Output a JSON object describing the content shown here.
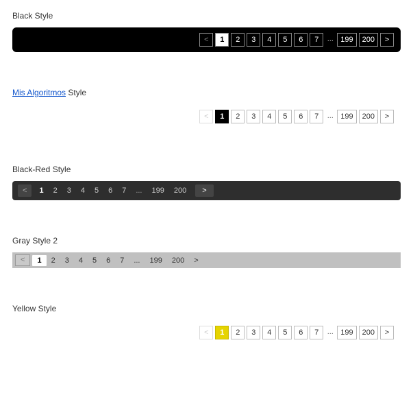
{
  "styles": [
    {
      "id": "black",
      "title_parts": [
        {
          "text": "Black Style",
          "link": false
        }
      ],
      "bar_class": "black-bar",
      "align": "right",
      "items": [
        {
          "t": "<",
          "role": "prev",
          "disabled": true
        },
        {
          "t": "1",
          "role": "page",
          "current": true
        },
        {
          "t": "2",
          "role": "page"
        },
        {
          "t": "3",
          "role": "page"
        },
        {
          "t": "4",
          "role": "page"
        },
        {
          "t": "5",
          "role": "page"
        },
        {
          "t": "6",
          "role": "page"
        },
        {
          "t": "7",
          "role": "page"
        },
        {
          "t": "...",
          "role": "ellipsis"
        },
        {
          "t": "199",
          "role": "page"
        },
        {
          "t": "200",
          "role": "page"
        },
        {
          "t": ">",
          "role": "next"
        }
      ]
    },
    {
      "id": "mis",
      "title_parts": [
        {
          "text": "Mis Algoritmos",
          "link": true
        },
        {
          "text": " Style",
          "link": false
        }
      ],
      "bar_class": "mis-bar",
      "align": "right",
      "items": [
        {
          "t": "<",
          "role": "prev",
          "disabled": true
        },
        {
          "t": "1",
          "role": "page",
          "current": true
        },
        {
          "t": "2",
          "role": "page"
        },
        {
          "t": "3",
          "role": "page"
        },
        {
          "t": "4",
          "role": "page"
        },
        {
          "t": "5",
          "role": "page"
        },
        {
          "t": "6",
          "role": "page"
        },
        {
          "t": "7",
          "role": "page"
        },
        {
          "t": "...",
          "role": "ellipsis"
        },
        {
          "t": "199",
          "role": "page"
        },
        {
          "t": "200",
          "role": "page"
        },
        {
          "t": ">",
          "role": "next"
        }
      ]
    },
    {
      "id": "darkred",
      "title_parts": [
        {
          "text": "Black-Red Style",
          "link": false
        }
      ],
      "bar_class": "darkred-bar",
      "align": "left",
      "items": [
        {
          "t": "<",
          "role": "prev",
          "disabled": true
        },
        {
          "t": "1",
          "role": "page",
          "current": true
        },
        {
          "t": "2",
          "role": "page"
        },
        {
          "t": "3",
          "role": "page"
        },
        {
          "t": "4",
          "role": "page"
        },
        {
          "t": "5",
          "role": "page"
        },
        {
          "t": "6",
          "role": "page"
        },
        {
          "t": "7",
          "role": "page"
        },
        {
          "t": "...",
          "role": "ellipsis"
        },
        {
          "t": "199",
          "role": "page"
        },
        {
          "t": "200",
          "role": "page"
        },
        {
          "t": ">",
          "role": "next"
        }
      ]
    },
    {
      "id": "gray2",
      "title_parts": [
        {
          "text": "Gray Style 2",
          "link": false
        }
      ],
      "bar_class": "gray2-bar",
      "align": "left",
      "items": [
        {
          "t": "<",
          "role": "prev",
          "disabled": true
        },
        {
          "t": "1",
          "role": "page",
          "current": true
        },
        {
          "t": "2",
          "role": "page"
        },
        {
          "t": "3",
          "role": "page"
        },
        {
          "t": "4",
          "role": "page"
        },
        {
          "t": "5",
          "role": "page"
        },
        {
          "t": "6",
          "role": "page"
        },
        {
          "t": "7",
          "role": "page"
        },
        {
          "t": "...",
          "role": "ellipsis"
        },
        {
          "t": "199",
          "role": "page"
        },
        {
          "t": "200",
          "role": "page"
        },
        {
          "t": ">",
          "role": "next"
        }
      ]
    },
    {
      "id": "yellow",
      "title_parts": [
        {
          "text": "Yellow Style",
          "link": false
        }
      ],
      "bar_class": "yellow-bar",
      "align": "right",
      "items": [
        {
          "t": "<",
          "role": "prev",
          "disabled": true
        },
        {
          "t": "1",
          "role": "page",
          "current": true
        },
        {
          "t": "2",
          "role": "page"
        },
        {
          "t": "3",
          "role": "page"
        },
        {
          "t": "4",
          "role": "page"
        },
        {
          "t": "5",
          "role": "page"
        },
        {
          "t": "6",
          "role": "page"
        },
        {
          "t": "7",
          "role": "page"
        },
        {
          "t": "...",
          "role": "ellipsis"
        },
        {
          "t": "199",
          "role": "page"
        },
        {
          "t": "200",
          "role": "page"
        },
        {
          "t": ">",
          "role": "next"
        }
      ]
    }
  ]
}
